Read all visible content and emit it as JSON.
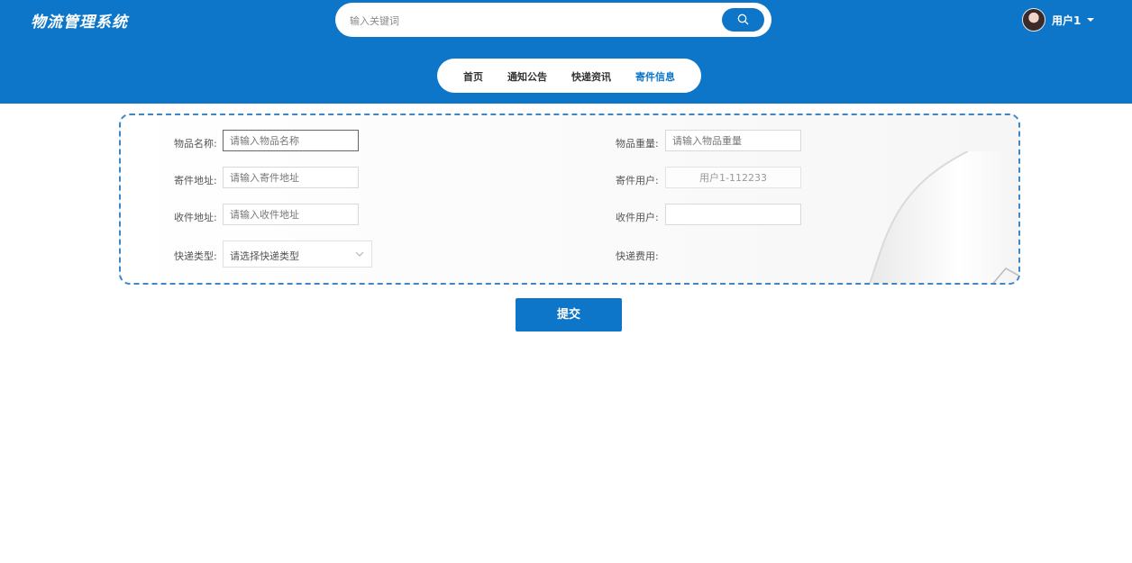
{
  "app": {
    "title": "物流管理系统"
  },
  "search": {
    "placeholder": "输入关键词"
  },
  "user": {
    "name": "用户1"
  },
  "nav": {
    "items": [
      {
        "label": "首页",
        "active": false
      },
      {
        "label": "通知公告",
        "active": false
      },
      {
        "label": "快递资讯",
        "active": false
      },
      {
        "label": "寄件信息",
        "active": true
      }
    ]
  },
  "form": {
    "item_name": {
      "label": "物品名称:",
      "placeholder": "请输入物品名称",
      "value": ""
    },
    "item_weight": {
      "label": "物品重量:",
      "placeholder": "请输入物品重量",
      "value": ""
    },
    "sender_address": {
      "label": "寄件地址:",
      "placeholder": "请输入寄件地址",
      "value": ""
    },
    "sender_user": {
      "label": "寄件用户:",
      "value": "用户1-112233"
    },
    "receiver_address": {
      "label": "收件地址:",
      "placeholder": "请输入收件地址",
      "value": ""
    },
    "receiver_user": {
      "label": "收件用户:",
      "value": ""
    },
    "express_type": {
      "label": "快递类型:",
      "placeholder": "请选择快递类型"
    },
    "express_fee": {
      "label": "快递费用:",
      "value": ""
    }
  },
  "actions": {
    "submit_label": "提交"
  },
  "colors": {
    "primary": "#0d76c8",
    "panel_border": "#3e86c8"
  },
  "icons": {
    "search": "search-icon",
    "caret": "caret-down-icon",
    "select_arrow": "chevron-down-icon"
  }
}
